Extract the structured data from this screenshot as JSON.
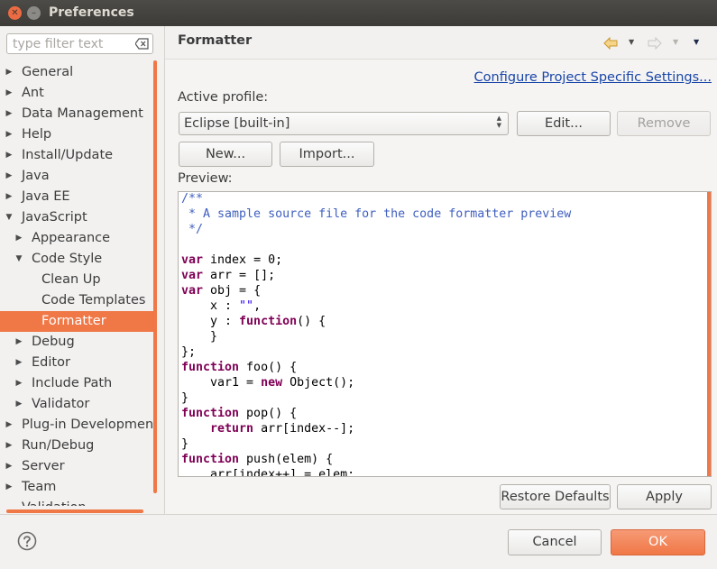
{
  "window": {
    "title": "Preferences"
  },
  "filter": {
    "placeholder": "type filter text"
  },
  "tree": [
    {
      "label": "General",
      "level": 0,
      "arrow": "right"
    },
    {
      "label": "Ant",
      "level": 0,
      "arrow": "right"
    },
    {
      "label": "Data Management",
      "level": 0,
      "arrow": "right"
    },
    {
      "label": "Help",
      "level": 0,
      "arrow": "right"
    },
    {
      "label": "Install/Update",
      "level": 0,
      "arrow": "right"
    },
    {
      "label": "Java",
      "level": 0,
      "arrow": "right"
    },
    {
      "label": "Java EE",
      "level": 0,
      "arrow": "right"
    },
    {
      "label": "JavaScript",
      "level": 0,
      "arrow": "down"
    },
    {
      "label": "Appearance",
      "level": 1,
      "arrow": "right"
    },
    {
      "label": "Code Style",
      "level": 1,
      "arrow": "down"
    },
    {
      "label": "Clean Up",
      "level": 2,
      "arrow": ""
    },
    {
      "label": "Code Templates",
      "level": 2,
      "arrow": ""
    },
    {
      "label": "Formatter",
      "level": 2,
      "arrow": "",
      "selected": true
    },
    {
      "label": "Debug",
      "level": 1,
      "arrow": "right"
    },
    {
      "label": "Editor",
      "level": 1,
      "arrow": "right"
    },
    {
      "label": "Include Path",
      "level": 1,
      "arrow": "right"
    },
    {
      "label": "Validator",
      "level": 1,
      "arrow": "right"
    },
    {
      "label": "Plug-in Development",
      "level": 0,
      "arrow": "right"
    },
    {
      "label": "Run/Debug",
      "level": 0,
      "arrow": "right"
    },
    {
      "label": "Server",
      "level": 0,
      "arrow": "right"
    },
    {
      "label": "Team",
      "level": 0,
      "arrow": "right"
    },
    {
      "label": "Validation",
      "level": 0,
      "arrow": ""
    }
  ],
  "page": {
    "title": "Formatter",
    "configure_link": "Configure Project Specific Settings...",
    "active_profile_label": "Active profile:",
    "profile_value": "Eclipse [built-in]",
    "edit_label": "Edit...",
    "remove_label": "Remove",
    "new_label": "New...",
    "import_label": "Import...",
    "preview_label": "Preview:",
    "restore_defaults_label": "Restore Defaults",
    "apply_label": "Apply"
  },
  "preview_code": [
    [
      [
        "cm",
        "/**"
      ]
    ],
    [
      [
        "cm",
        " * A sample source file for the code formatter preview"
      ]
    ],
    [
      [
        "cm",
        " */"
      ]
    ],
    [
      [
        "",
        ""
      ]
    ],
    [
      [
        "kw",
        "var"
      ],
      [
        "",
        " index = 0;"
      ]
    ],
    [
      [
        "kw",
        "var"
      ],
      [
        "",
        " arr = [];"
      ]
    ],
    [
      [
        "kw",
        "var"
      ],
      [
        "",
        " obj = {"
      ]
    ],
    [
      [
        "",
        "    x : "
      ],
      [
        "str",
        "\"\""
      ],
      [
        "",
        ","
      ]
    ],
    [
      [
        "",
        "    y : "
      ],
      [
        "kw",
        "function"
      ],
      [
        "",
        "() {"
      ]
    ],
    [
      [
        "",
        "    }"
      ]
    ],
    [
      [
        "",
        "};"
      ]
    ],
    [
      [
        "kw",
        "function"
      ],
      [
        "",
        " foo() {"
      ]
    ],
    [
      [
        "",
        "    var1 = "
      ],
      [
        "kw",
        "new"
      ],
      [
        "",
        " Object();"
      ]
    ],
    [
      [
        "",
        "}"
      ]
    ],
    [
      [
        "kw",
        "function"
      ],
      [
        "",
        " pop() {"
      ]
    ],
    [
      [
        "",
        "    "
      ],
      [
        "kw",
        "return"
      ],
      [
        "",
        " arr[index--];"
      ]
    ],
    [
      [
        "",
        "}"
      ]
    ],
    [
      [
        "kw",
        "function"
      ],
      [
        "",
        " push(elem) {"
      ]
    ],
    [
      [
        "",
        "    arr[index++] = elem;"
      ]
    ]
  ],
  "footer": {
    "cancel_label": "Cancel",
    "ok_label": "OK"
  },
  "colors": {
    "accent": "#f07746",
    "link": "#1a46a8",
    "comment": "#3f5fbf",
    "keyword": "#7f0055",
    "string": "#2a00ff"
  }
}
